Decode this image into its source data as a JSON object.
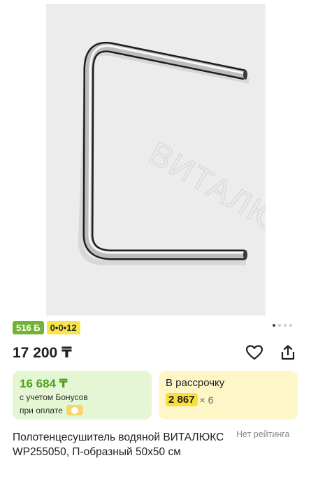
{
  "product": {
    "watermark": "ВИТАЛЮКС",
    "badges": {
      "bonus": "516 Б",
      "installment": "0•0•12"
    },
    "price": "17 200 ₸",
    "bonus_card": {
      "amount": "16 684 ₸",
      "line1": "с учетом Бонусов",
      "line2": "при оплате"
    },
    "installment_card": {
      "label": "В рассрочку",
      "monthly": "2 867",
      "times": "× 6"
    },
    "title": "Полотенцесушитель водяной ВИТАЛЮКС WP255050, П-образный 50х50 см",
    "rating": "Нет рейтинга"
  },
  "gallery": {
    "total": 4,
    "active": 1
  },
  "colors": {
    "bonus_green": "#6fb436",
    "installment_yellow": "#f7e54a",
    "bonus_card_bg": "#e5f6d4",
    "installment_card_bg": "#fdf6c6"
  },
  "icons": [
    "heart-icon",
    "share-icon",
    "wallet-icon"
  ]
}
